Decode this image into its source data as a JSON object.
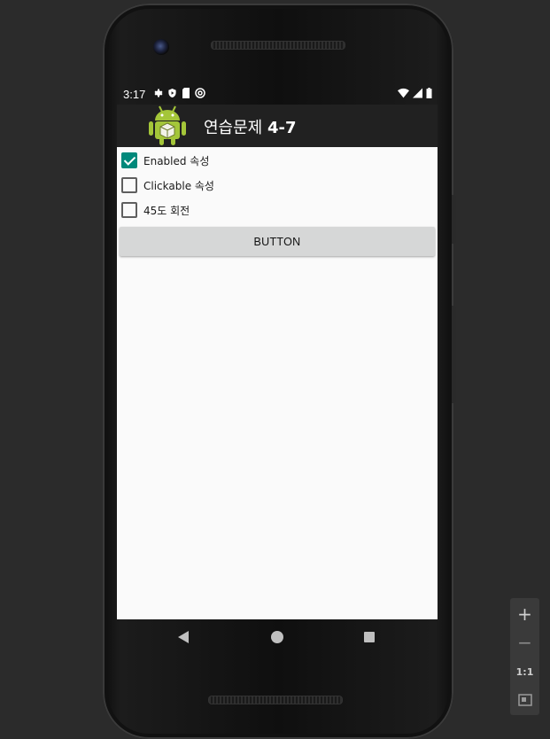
{
  "status_bar": {
    "time": "3:17",
    "left_icons": [
      "settings-icon",
      "shield-icon",
      "sd-card-icon",
      "do-not-disturb-icon"
    ],
    "right_icons": [
      "wifi-icon",
      "signal-icon",
      "battery-icon"
    ]
  },
  "action_bar": {
    "title_prefix": "연습문제 ",
    "title_number": "4-7",
    "icon": "android-robot-icon"
  },
  "checkboxes": [
    {
      "label": "Enabled 속성",
      "checked": true
    },
    {
      "label": "Clickable 속성",
      "checked": false
    },
    {
      "label": "45도 회전",
      "checked": false
    }
  ],
  "button": {
    "label": "BUTTON"
  },
  "navigation": [
    "back-icon",
    "home-icon",
    "recents-icon"
  ],
  "emulator_toolbar": {
    "zoom_in": "+",
    "zoom_out": "−",
    "one_to_one": "1:1"
  },
  "colors": {
    "accent": "#00897b",
    "action_bar": "#212121",
    "screen_background": "#fafafa",
    "button_background": "#d6d7d7"
  }
}
